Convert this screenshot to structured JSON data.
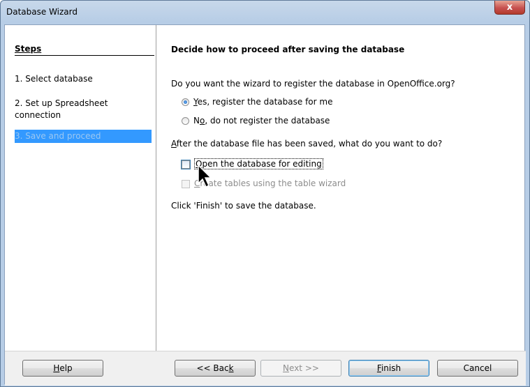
{
  "window": {
    "title": "Database Wizard",
    "close_glyph": "x"
  },
  "steps": {
    "heading": "Steps",
    "items": [
      {
        "label": "1. Select database"
      },
      {
        "label": "2. Set up Spreadsheet connection"
      },
      {
        "label": "3. Save and proceed"
      }
    ],
    "active_index": 2
  },
  "page": {
    "heading": "Decide how to proceed after saving the database",
    "register_question": "Do you want the wizard to register the database in OpenOffice.org?",
    "register_yes": {
      "mnemonic": "Y",
      "rest": "es, register the database for me",
      "selected": true
    },
    "register_no": {
      "pre": "N",
      "mnemonic": "o",
      "rest": ", do not register the database",
      "selected": false
    },
    "after_save_question": {
      "mnemonic": "A",
      "rest": "fter the database file has been saved, what do you want to do?"
    },
    "open_for_editing": {
      "mnemonic": "O",
      "rest": "pen the database for editing",
      "checked": false
    },
    "create_tables": {
      "mnemonic": "C",
      "rest": "reate tables using the table wizard",
      "checked": false,
      "enabled": false
    },
    "finish_note": "Click 'Finish' to save the database."
  },
  "buttons": {
    "help": {
      "mnemonic": "H",
      "rest": "elp"
    },
    "back": {
      "pre": "<< Bac",
      "mnemonic": "k"
    },
    "next": {
      "mnemonic": "N",
      "rest": "ext >>",
      "enabled": false
    },
    "finish": {
      "mnemonic": "F",
      "rest": "inish"
    },
    "cancel": "Cancel"
  },
  "colors": {
    "active_step_bg": "#3399ff",
    "title_gradient": "#b7cde6",
    "close_red": "#c75050"
  }
}
